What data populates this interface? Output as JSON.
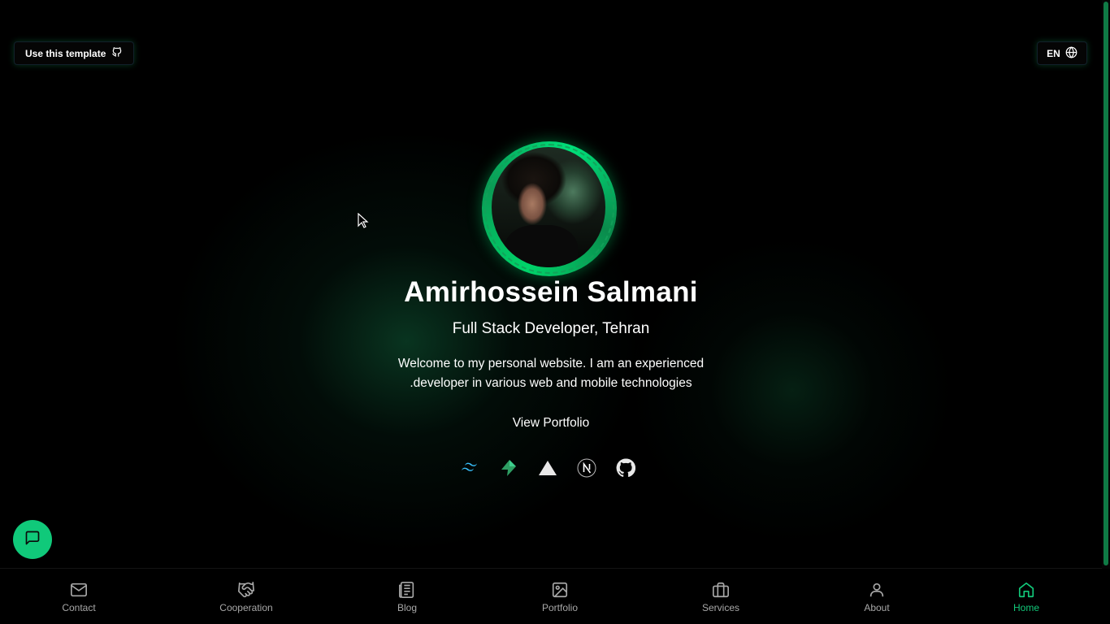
{
  "header": {
    "template_label": "Use this template",
    "lang_label": "EN"
  },
  "profile": {
    "name": "Amirhossein Salmani",
    "role": "Full Stack Developer, Tehran",
    "bio_line1": "Welcome to my personal website. I am an experienced",
    "bio_line2": ".developer in various web and mobile technologies",
    "view_portfolio": "View Portfolio"
  },
  "tech_icons": [
    "tailwind-icon",
    "supabase-icon",
    "vercel-icon",
    "nextjs-icon",
    "github-icon"
  ],
  "nav": {
    "items": [
      {
        "label": "Contact",
        "icon": "mail-icon"
      },
      {
        "label": "Cooperation",
        "icon": "handshake-icon"
      },
      {
        "label": "Blog",
        "icon": "newspaper-icon"
      },
      {
        "label": "Portfolio",
        "icon": "image-icon"
      },
      {
        "label": "Services",
        "icon": "briefcase-icon"
      },
      {
        "label": "About",
        "icon": "user-icon"
      },
      {
        "label": "Home",
        "icon": "home-icon"
      }
    ],
    "active": "Home"
  },
  "colors": {
    "accent": "#12c97a",
    "background": "#000000",
    "nav_text": "#a8a8a8"
  }
}
